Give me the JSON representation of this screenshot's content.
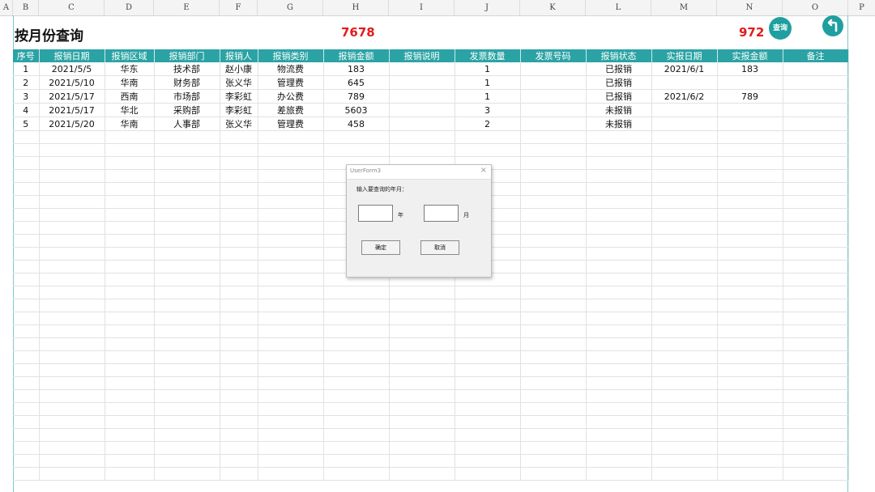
{
  "sheet": {
    "column_letters": [
      "A",
      "B",
      "C",
      "D",
      "E",
      "F",
      "G",
      "H",
      "I",
      "J",
      "K",
      "L",
      "M",
      "N",
      "O",
      "P"
    ],
    "title": "按月份查询",
    "total_amount": "7678",
    "total_actual": "972",
    "query_button_label": "查询",
    "back_button_icon": "return-arrow-icon"
  },
  "table": {
    "headers": [
      "序号",
      "报销日期",
      "报销区域",
      "报销部门",
      "报销人",
      "报销类别",
      "报销金额",
      "报销说明",
      "发票数量",
      "发票号码",
      "报销状态",
      "实报日期",
      "实报金额",
      "备注"
    ],
    "rows": [
      [
        "1",
        "2021/5/5",
        "华东",
        "技术部",
        "赵小康",
        "物流费",
        "183",
        "",
        "1",
        "",
        "已报销",
        "2021/6/1",
        "183",
        ""
      ],
      [
        "2",
        "2021/5/10",
        "华南",
        "财务部",
        "张义华",
        "管理费",
        "645",
        "",
        "1",
        "",
        "已报销",
        "",
        "",
        ""
      ],
      [
        "3",
        "2021/5/17",
        "西南",
        "市场部",
        "李彩虹",
        "办公费",
        "789",
        "",
        "1",
        "",
        "已报销",
        "2021/6/2",
        "789",
        ""
      ],
      [
        "4",
        "2021/5/17",
        "华北",
        "采购部",
        "李彩虹",
        "差旅费",
        "5603",
        "",
        "3",
        "",
        "未报销",
        "",
        "",
        ""
      ],
      [
        "5",
        "2021/5/20",
        "华南",
        "人事部",
        "张义华",
        "管理费",
        "458",
        "",
        "2",
        "",
        "未报销",
        "",
        "",
        ""
      ]
    ]
  },
  "dialog": {
    "title": "UserForm3",
    "close_glyph": "×",
    "prompt": "输入要查询的年月：",
    "year_value": "",
    "year_unit": "年",
    "month_value": "",
    "month_unit": "月",
    "ok_label": "确定",
    "cancel_label": "取消"
  },
  "colors": {
    "header_teal": "#2ba3a4",
    "highlight_red": "#e41b1b",
    "button_teal": "#1f9fa0"
  }
}
